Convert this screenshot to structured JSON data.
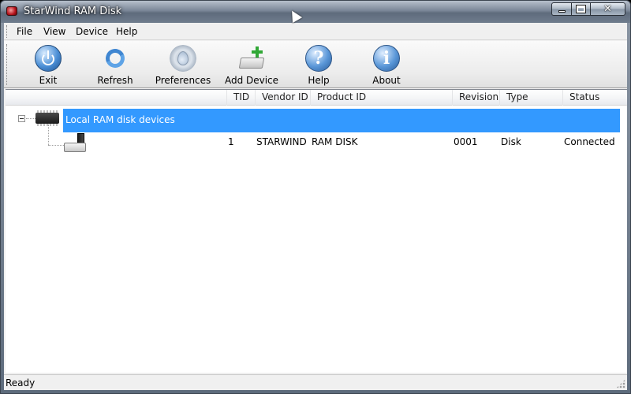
{
  "window": {
    "title": "StarWind RAM Disk",
    "controls": {
      "minimize": "minimize",
      "maximize": "maximize",
      "close": "✕"
    }
  },
  "menubar": {
    "items": [
      {
        "label": "File"
      },
      {
        "label": "View"
      },
      {
        "label": "Device"
      },
      {
        "label": "Help"
      }
    ]
  },
  "toolbar": {
    "buttons": [
      {
        "label": "Exit",
        "icon": "power-icon"
      },
      {
        "label": "Refresh",
        "icon": "refresh-icon"
      },
      {
        "label": "Preferences",
        "icon": "preferences-icon"
      },
      {
        "label": "Add Device",
        "icon": "add-device-icon"
      },
      {
        "label": "Help",
        "icon": "help-icon",
        "glyph": "?"
      },
      {
        "label": "About",
        "icon": "info-icon",
        "glyph": "i"
      }
    ]
  },
  "list": {
    "columns": [
      "TID",
      "Vendor ID",
      "Product ID",
      "Revision",
      "Type",
      "Status"
    ],
    "group": {
      "label": "Local RAM disk devices",
      "expander": "−"
    },
    "rows": [
      {
        "tid": "1",
        "vendor_id": "STARWIND",
        "product_id": "RAM DISK",
        "revision": "0001",
        "type": "Disk",
        "status": "Connected"
      }
    ],
    "selection_color": "#3399ff"
  },
  "statusbar": {
    "text": "Ready"
  }
}
